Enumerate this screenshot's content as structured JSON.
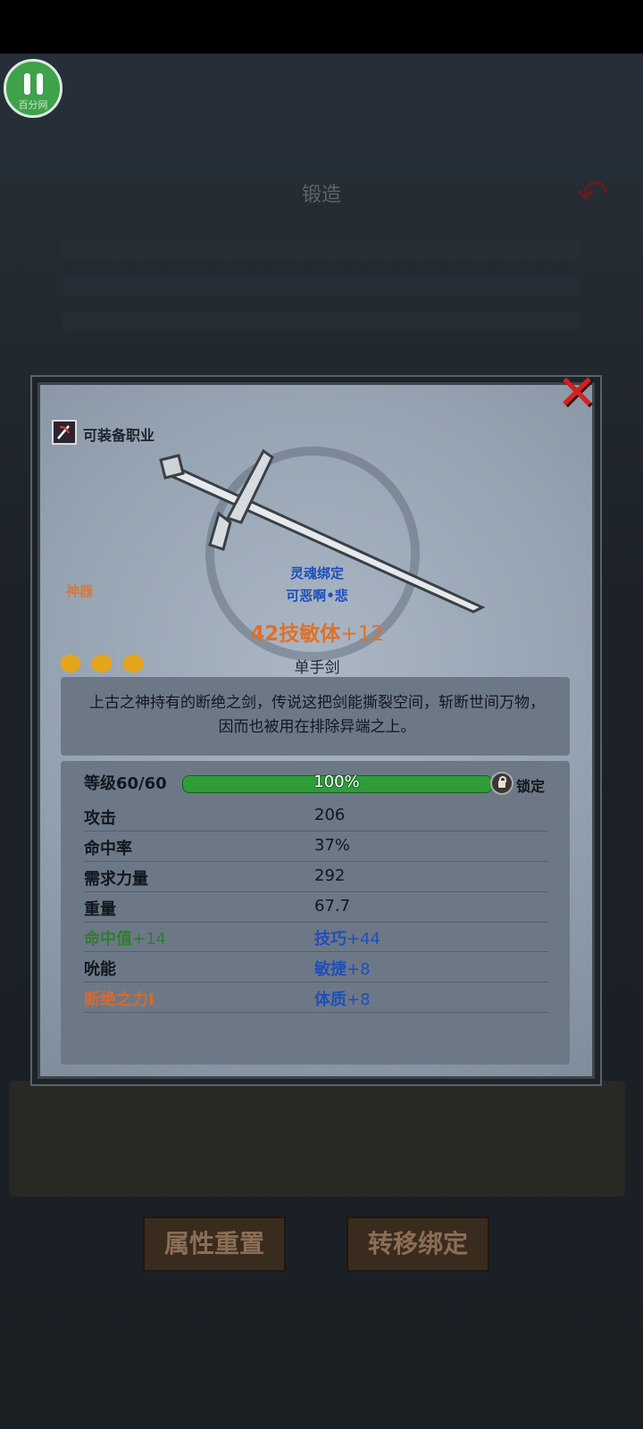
{
  "app": {
    "watermark": "百分网"
  },
  "background": {
    "header_title": "锻造",
    "bottom_buttons": {
      "reset": "属性重置",
      "transfer": "转移绑定"
    }
  },
  "item": {
    "job_label": "可装备职业",
    "rarity": "神器",
    "soul_bound": "灵魂绑定",
    "owner": "可恶啊•悲",
    "name_prefix": "42技敏体",
    "name_enhance": "+12",
    "weapon_type": "单手剑",
    "stars": 3,
    "description": "上古之神持有的断绝之剑，传说这把剑能撕裂空间，斩断世间万物，因而也被用在排除异端之上。",
    "level": {
      "label": "等级60/60",
      "progress_text": "100%",
      "progress": 1.0,
      "lock_label": "锁定"
    },
    "stats": [
      {
        "key": "攻击",
        "value": "206"
      },
      {
        "key": "命中率",
        "value": "37%"
      },
      {
        "key": "需求力量",
        "value": "292"
      },
      {
        "key": "重量",
        "value": "67.7"
      }
    ],
    "bonus_rows": [
      {
        "key_main": "命中值",
        "key_num": "+14",
        "val_main": "技巧",
        "val_num": "+44"
      },
      {
        "key_main": "吮能",
        "key_num": "",
        "val_main": "敏捷",
        "val_num": "+8"
      },
      {
        "key_main": "断绝之力I",
        "key_num": "",
        "val_main": "体质",
        "val_num": "+8"
      }
    ]
  },
  "colors": {
    "accent_orange": "#e0702a",
    "bound_blue": "#1f4fb8",
    "close_red": "#d62020",
    "xp_green": "#2f9c3a"
  }
}
